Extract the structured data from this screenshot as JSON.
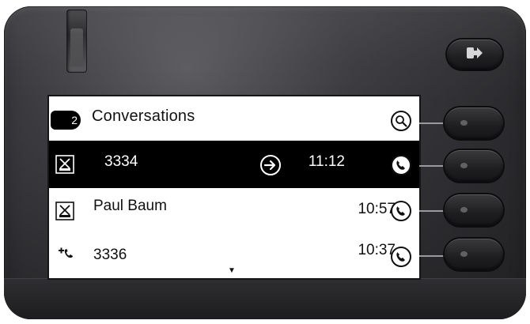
{
  "header": {
    "title": "Conversations",
    "count_badge": "2"
  },
  "conversations": [
    {
      "number": "3334",
      "time": "11:12",
      "icon": "missed-call-icon",
      "selected": true,
      "has_arrow": true
    },
    {
      "name": "Paul Baum",
      "time": "10:57",
      "icon": "missed-call-icon",
      "selected": false
    },
    {
      "number": "3336",
      "time": "10:37",
      "icon": "outgoing-call-icon",
      "selected": false
    }
  ],
  "colors": {
    "body_dark": "#2a2a2d",
    "selection_bg": "#000000",
    "screen_bg": "#ffffff"
  }
}
